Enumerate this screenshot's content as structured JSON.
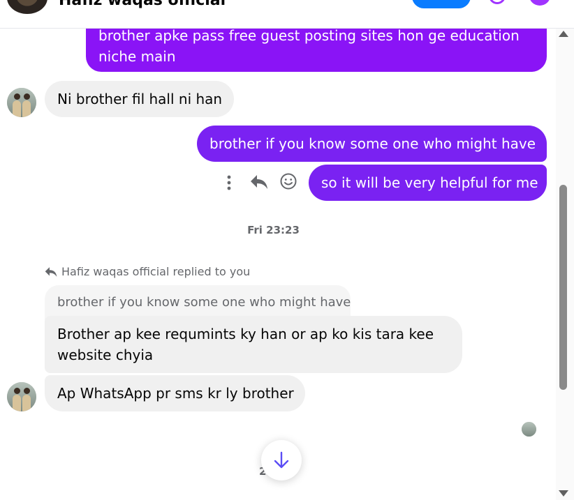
{
  "header": {
    "contact_name": "Hafiz waqas official"
  },
  "messages": {
    "m1": {
      "line1": "brother apke pass free guest posting sites hon ge education",
      "line2": "niche main"
    },
    "m2": "Ni brother fil hall ni han",
    "m3": "brother if you know some one who might have",
    "m4": "so it will be very helpful for me",
    "timestamp": "Fri 23:23",
    "reply_meta": "Hafiz waqas official replied to you",
    "quoted": "brother if you know some one who might have",
    "m5": {
      "line1": "Brother ap kee requmints ky han or ap ko kis tara kee",
      "line2": "website chyia"
    },
    "m6": "Ap WhatsApp pr sms kr ly brother",
    "partial_time": "2"
  },
  "icons": [
    "more-options-icon",
    "reply-icon",
    "emoji-react-icon",
    "arrow-down-icon",
    "reply-arrow-icon"
  ],
  "colors": {
    "outgoing": "#8a14f6",
    "outgoing_alt": "#7a22f2",
    "incoming": "#f0f0f0",
    "accent": "#a033ff",
    "link_blue": "#0a7cff"
  }
}
